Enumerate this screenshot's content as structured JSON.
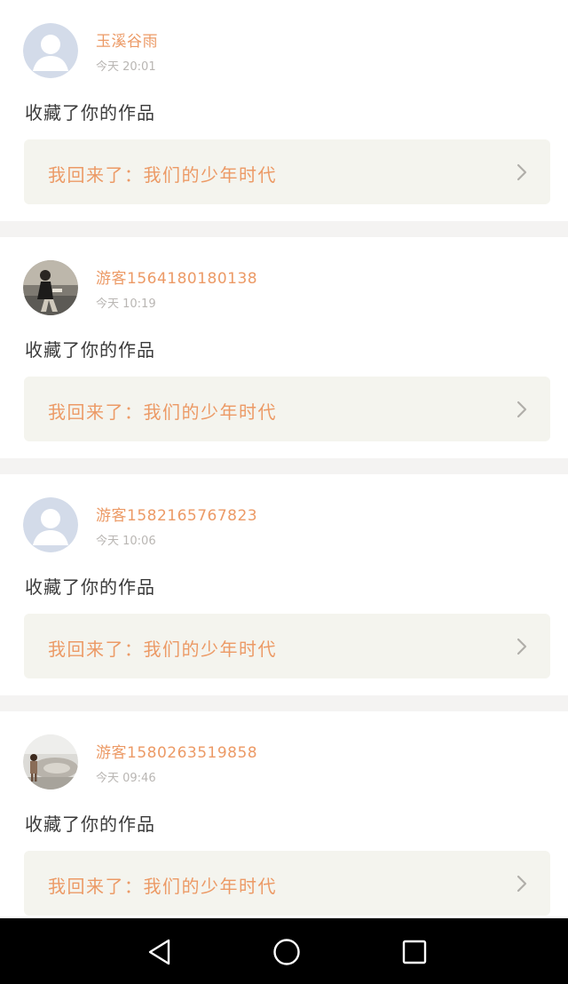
{
  "notifications": [
    {
      "user_name": "玉溪谷雨",
      "time": "今天 20:01",
      "avatar": "default-avatar-icon",
      "action": "收藏了你的作品",
      "work_title": "我回来了：我们的少年时代"
    },
    {
      "user_name": "游客1564180180138",
      "time": "今天 10:19",
      "avatar": "photo-avatar",
      "action": "收藏了你的作品",
      "work_title": "我回来了：我们的少年时代"
    },
    {
      "user_name": "游客1582165767823",
      "time": "今天 10:06",
      "avatar": "default-avatar-icon",
      "action": "收藏了你的作品",
      "work_title": "我回来了：我们的少年时代"
    },
    {
      "user_name": "游客1580263519858",
      "time": "今天 09:46",
      "avatar": "photo-avatar",
      "action": "收藏了你的作品",
      "work_title": "我回来了：我们的少年时代"
    }
  ],
  "navbar": {
    "back": "back-triangle-icon",
    "home": "home-circle-icon",
    "recents": "recents-square-icon"
  },
  "colors": {
    "accent": "#ec9a66",
    "time": "#b9b6b3",
    "body_text": "#3b3b3b",
    "link_bg": "#f4f4ee",
    "separator": "#f4f3f2",
    "navbar": "#000000"
  }
}
